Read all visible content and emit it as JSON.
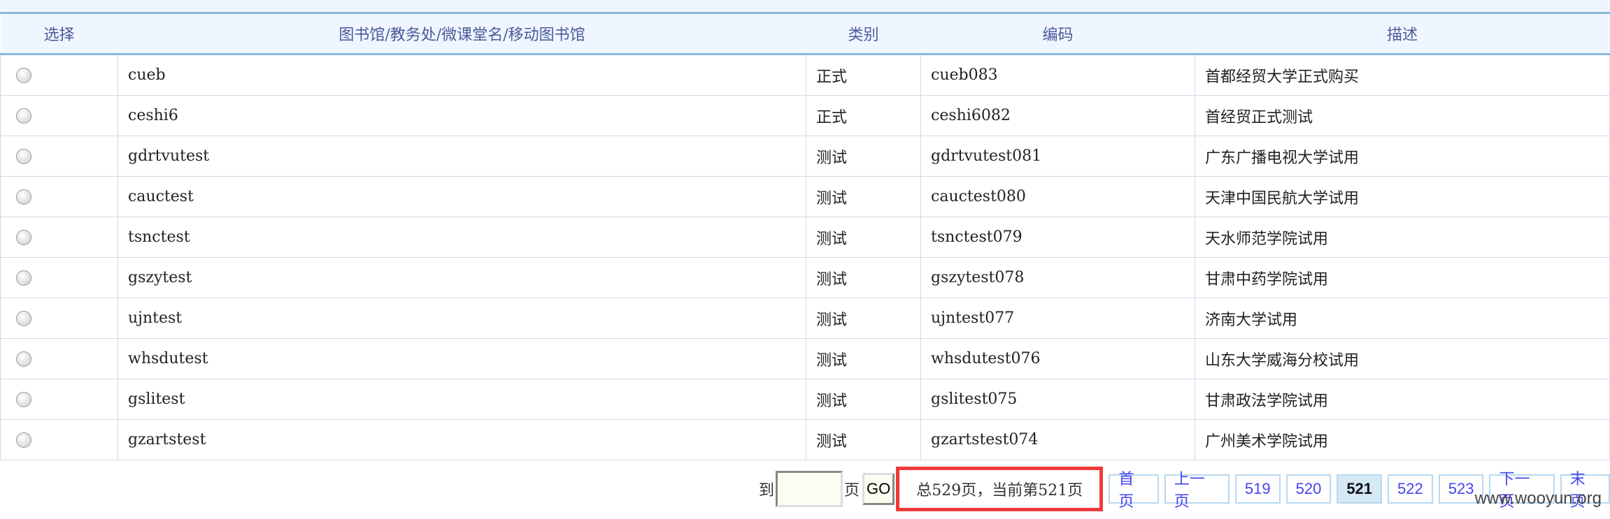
{
  "table": {
    "headers": [
      "选择",
      "图书馆/教务处/微课堂名/移动图书馆",
      "类别",
      "编码",
      "描述"
    ],
    "rows": [
      [
        "cueb",
        "正式",
        "cueb083",
        "首都经贸大学正式购买"
      ],
      [
        "ceshi6",
        "正式",
        "ceshi6082",
        "首经贸正式测试"
      ],
      [
        "gdrtvutest",
        "测试",
        "gdrtvutest081",
        "广东广播电视大学试用"
      ],
      [
        "cauctest",
        "测试",
        "cauctest080",
        "天津中国民航大学试用"
      ],
      [
        "tsnctest",
        "测试",
        "tsnctest079",
        "天水师范学院试用"
      ],
      [
        "gszytest",
        "测试",
        "gszytest078",
        "甘肃中药学院试用"
      ],
      [
        "ujntest",
        "测试",
        "ujntest077",
        "济南大学试用"
      ],
      [
        "whsdutest",
        "测试",
        "whsdutest076",
        "山东大学威海分校试用"
      ],
      [
        "gslitest",
        "测试",
        "gslitest075",
        "甘肃政法学院试用"
      ],
      [
        "gzartstest",
        "测试",
        "gzartstest074",
        "广州美术学院试用"
      ]
    ]
  },
  "pager": {
    "goto_label": "到",
    "page_label": "页",
    "go": "GO",
    "input_value": "",
    "info": "总529页，当前第521页",
    "first": "首页",
    "prev": "上一页",
    "pages": [
      "519",
      "520",
      "521",
      "522",
      "523"
    ],
    "current": "521",
    "next": "下一页",
    "last": "末页"
  },
  "watermark": "www.wooyun.org"
}
